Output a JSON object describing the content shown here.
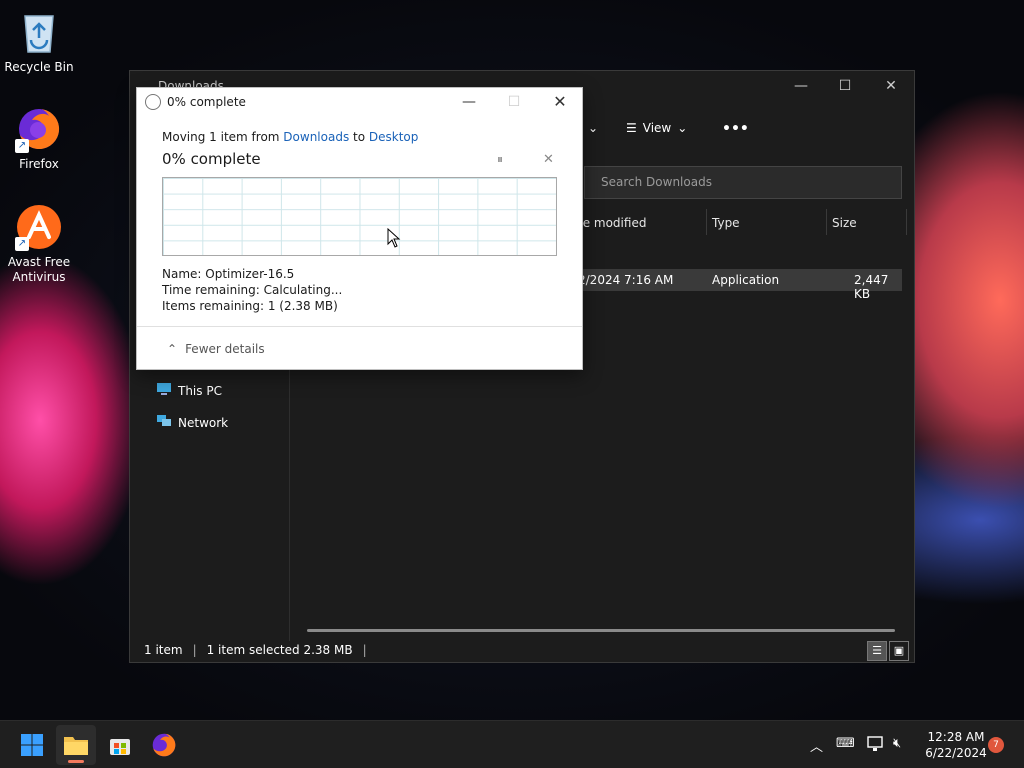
{
  "desktop": {
    "icons": [
      {
        "label": "Recycle Bin",
        "icon": "recycle-bin-icon"
      },
      {
        "label": "Firefox",
        "icon": "firefox-icon"
      },
      {
        "label": "Avast Free Antivirus",
        "label_line1": "Avast Free",
        "label_line2": "Antivirus",
        "icon": "avast-icon"
      }
    ]
  },
  "explorer": {
    "title": "Downloads",
    "toolbar": {
      "view_label": "View",
      "more_label": "•••"
    },
    "search_placeholder": "Search Downloads",
    "columns": {
      "date_modified": "te modified",
      "type": "Type",
      "size": "Size"
    },
    "file": {
      "date": "2/2024 7:16 AM",
      "type": "Application",
      "size": "2,447 KB"
    },
    "nav": [
      {
        "label": "This PC",
        "icon": "this-pc-icon"
      },
      {
        "label": "Network",
        "icon": "network-icon"
      }
    ],
    "status": {
      "items": "1 item",
      "selected": "1 item selected  2.38 MB"
    }
  },
  "dialog": {
    "title": "0% complete",
    "moving_prefix": "Moving 1 item from ",
    "source": "Downloads",
    "moving_mid": " to ",
    "destination": "Desktop",
    "percent_text": "0% complete",
    "progress": 0,
    "name_line": "Name:  Optimizer-16.5",
    "time_line": "Time remaining:  Calculating...",
    "items_line": "Items remaining:  1 (2.38 MB)",
    "fewer_details": "Fewer details"
  },
  "taskbar": {
    "time": "12:28 AM",
    "date": "6/22/2024",
    "notification_count": "7"
  }
}
